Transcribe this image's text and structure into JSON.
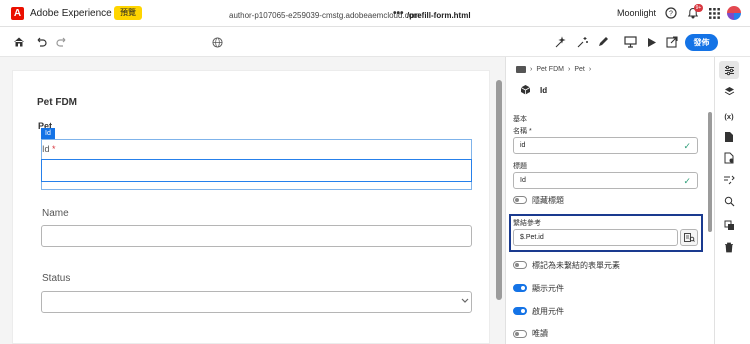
{
  "header": {
    "app_title": "Adobe Experience Cloud",
    "preview_badge": "預覽",
    "org_name": "Moonlight",
    "notification_count": "9+"
  },
  "toolbar": {
    "url": "author-p107065-e259039-cmstg.adobeaemcloud.com",
    "url_dots": "•••",
    "path": "/prefill-form.html",
    "publish_label": "發佈"
  },
  "canvas": {
    "form_title": "Pet FDM",
    "panel_title": "Pet",
    "selected_tag": "Id",
    "id_label": "Id",
    "id_required": "*",
    "name_label": "Name",
    "status_label": "Status"
  },
  "properties": {
    "breadcrumb": [
      "Pet FDM",
      "Pet"
    ],
    "component_name": "Id",
    "section_basic": "基本",
    "name_label": "名稱 *",
    "name_value": "id",
    "title_label": "標題",
    "title_value": "Id",
    "hide_title": "隱藏標題",
    "bind_ref_label": "繫結參考",
    "bind_ref_value": "$.Pet.id",
    "mark_unbound": "標記為未繫結的表單元素",
    "show_component": "顯示元件",
    "enable_component": "啟用元件",
    "readonly": "唯讀"
  },
  "toggles": {
    "hide_title": false,
    "mark_unbound": false,
    "show_component": true,
    "enable_component": true,
    "readonly": false
  },
  "colors": {
    "accent": "#1473e6",
    "adobe_red": "#eb1000",
    "preview_yellow": "#ffd500",
    "highlight_border": "#1a3a8f"
  }
}
